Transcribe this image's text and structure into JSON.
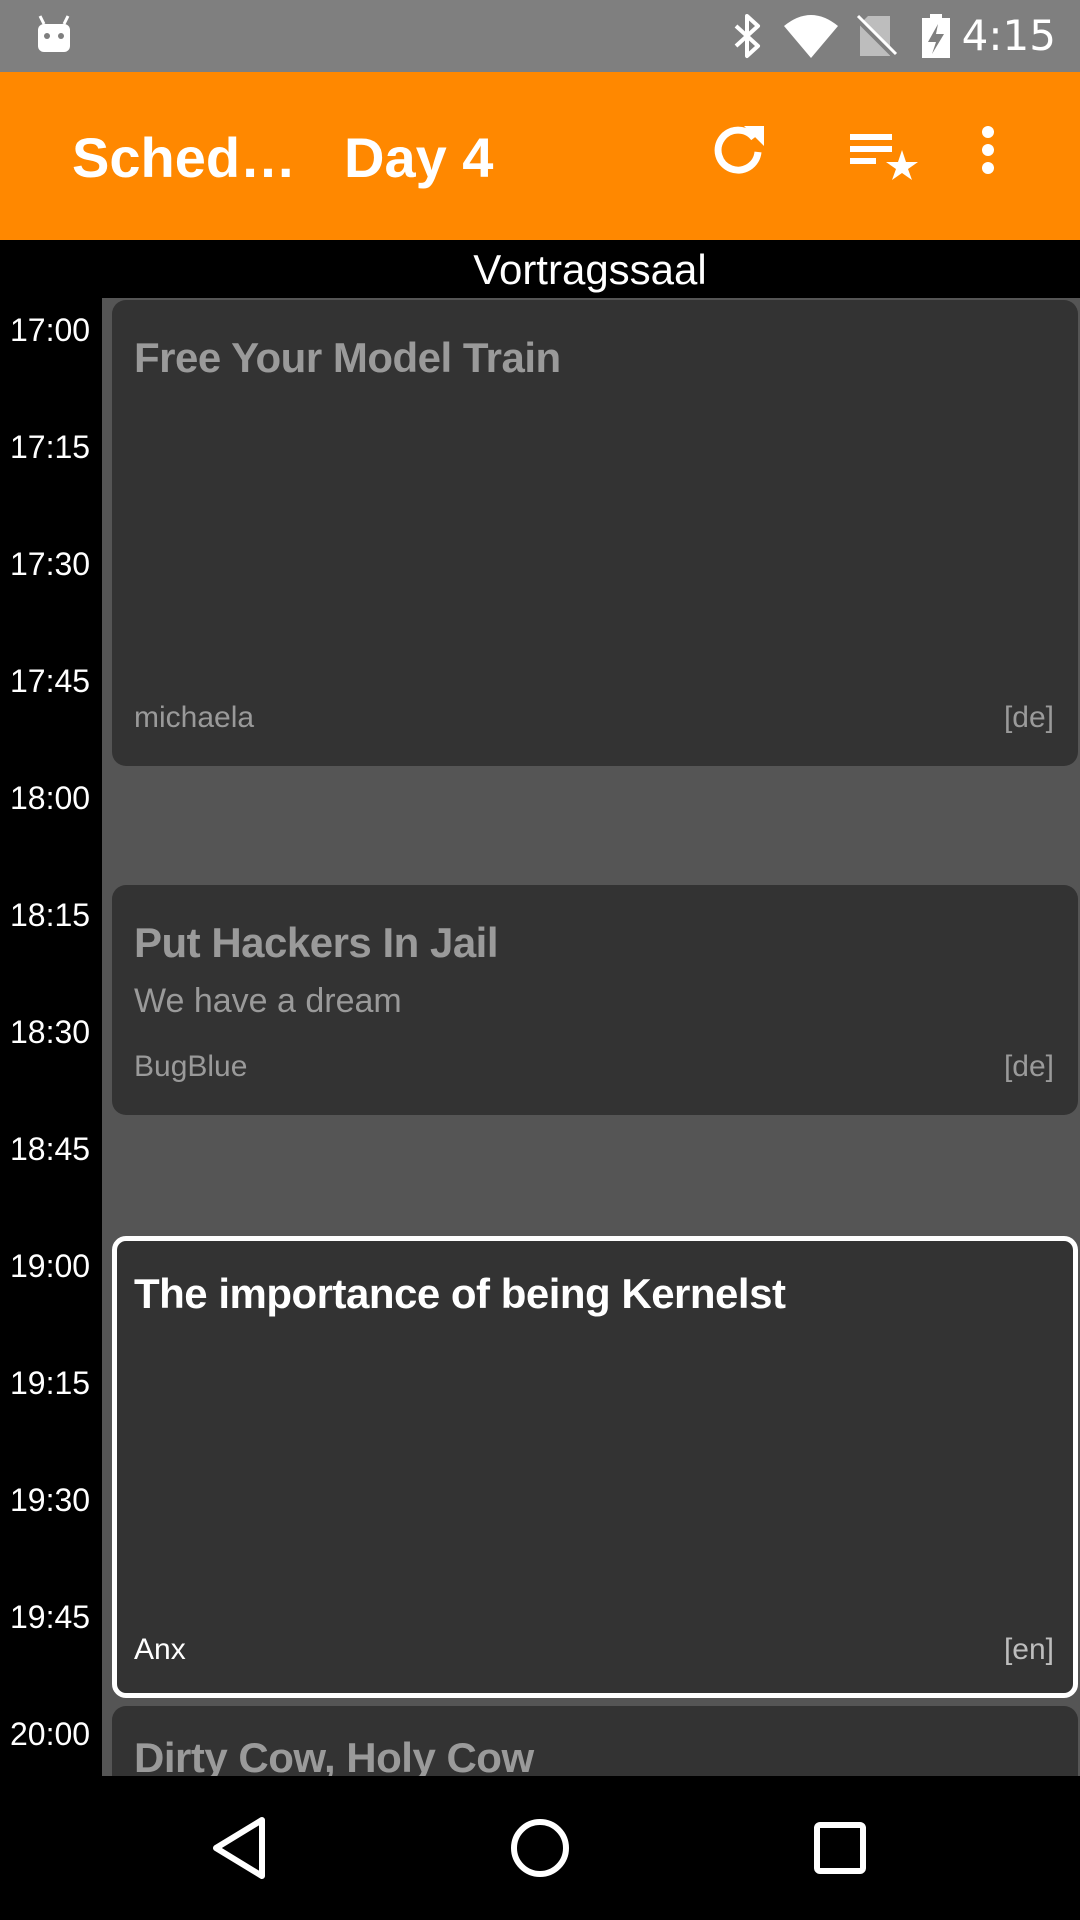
{
  "status_bar": {
    "time": "4:15",
    "icons": [
      "android-debug-icon",
      "bluetooth-icon",
      "wifi-icon",
      "no-sim-icon",
      "battery-charging-icon"
    ]
  },
  "toolbar": {
    "title": "Sched…",
    "day_selected": "Day 4",
    "icons": [
      "dropdown-arrow-icon",
      "refresh-icon",
      "starred-list-icon",
      "overflow-menu-icon"
    ],
    "accent_color": "#ff8800"
  },
  "room": {
    "name": "Vortragssaal"
  },
  "times": [
    "17:00",
    "17:15",
    "17:30",
    "17:45",
    "18:00",
    "18:15",
    "18:30",
    "18:45",
    "19:00",
    "19:15",
    "19:30",
    "19:45",
    "20:00"
  ],
  "events": [
    {
      "title": "Free Your Model Train",
      "subtitle": "",
      "speaker": "michaela",
      "lang": "[de]"
    },
    {
      "title": "Put Hackers In Jail",
      "subtitle": "We have a dream",
      "speaker": "BugBlue",
      "lang": "[de]"
    },
    {
      "title": "The importance of being Kernelst",
      "subtitle": "",
      "speaker": "Anx",
      "lang": "[en]"
    },
    {
      "title": "Dirty Cow, Holy Cow",
      "subtitle": "",
      "speaker": "",
      "lang": ""
    }
  ],
  "nav_bar": {
    "icons": [
      "back-icon",
      "home-icon",
      "recents-icon"
    ]
  }
}
